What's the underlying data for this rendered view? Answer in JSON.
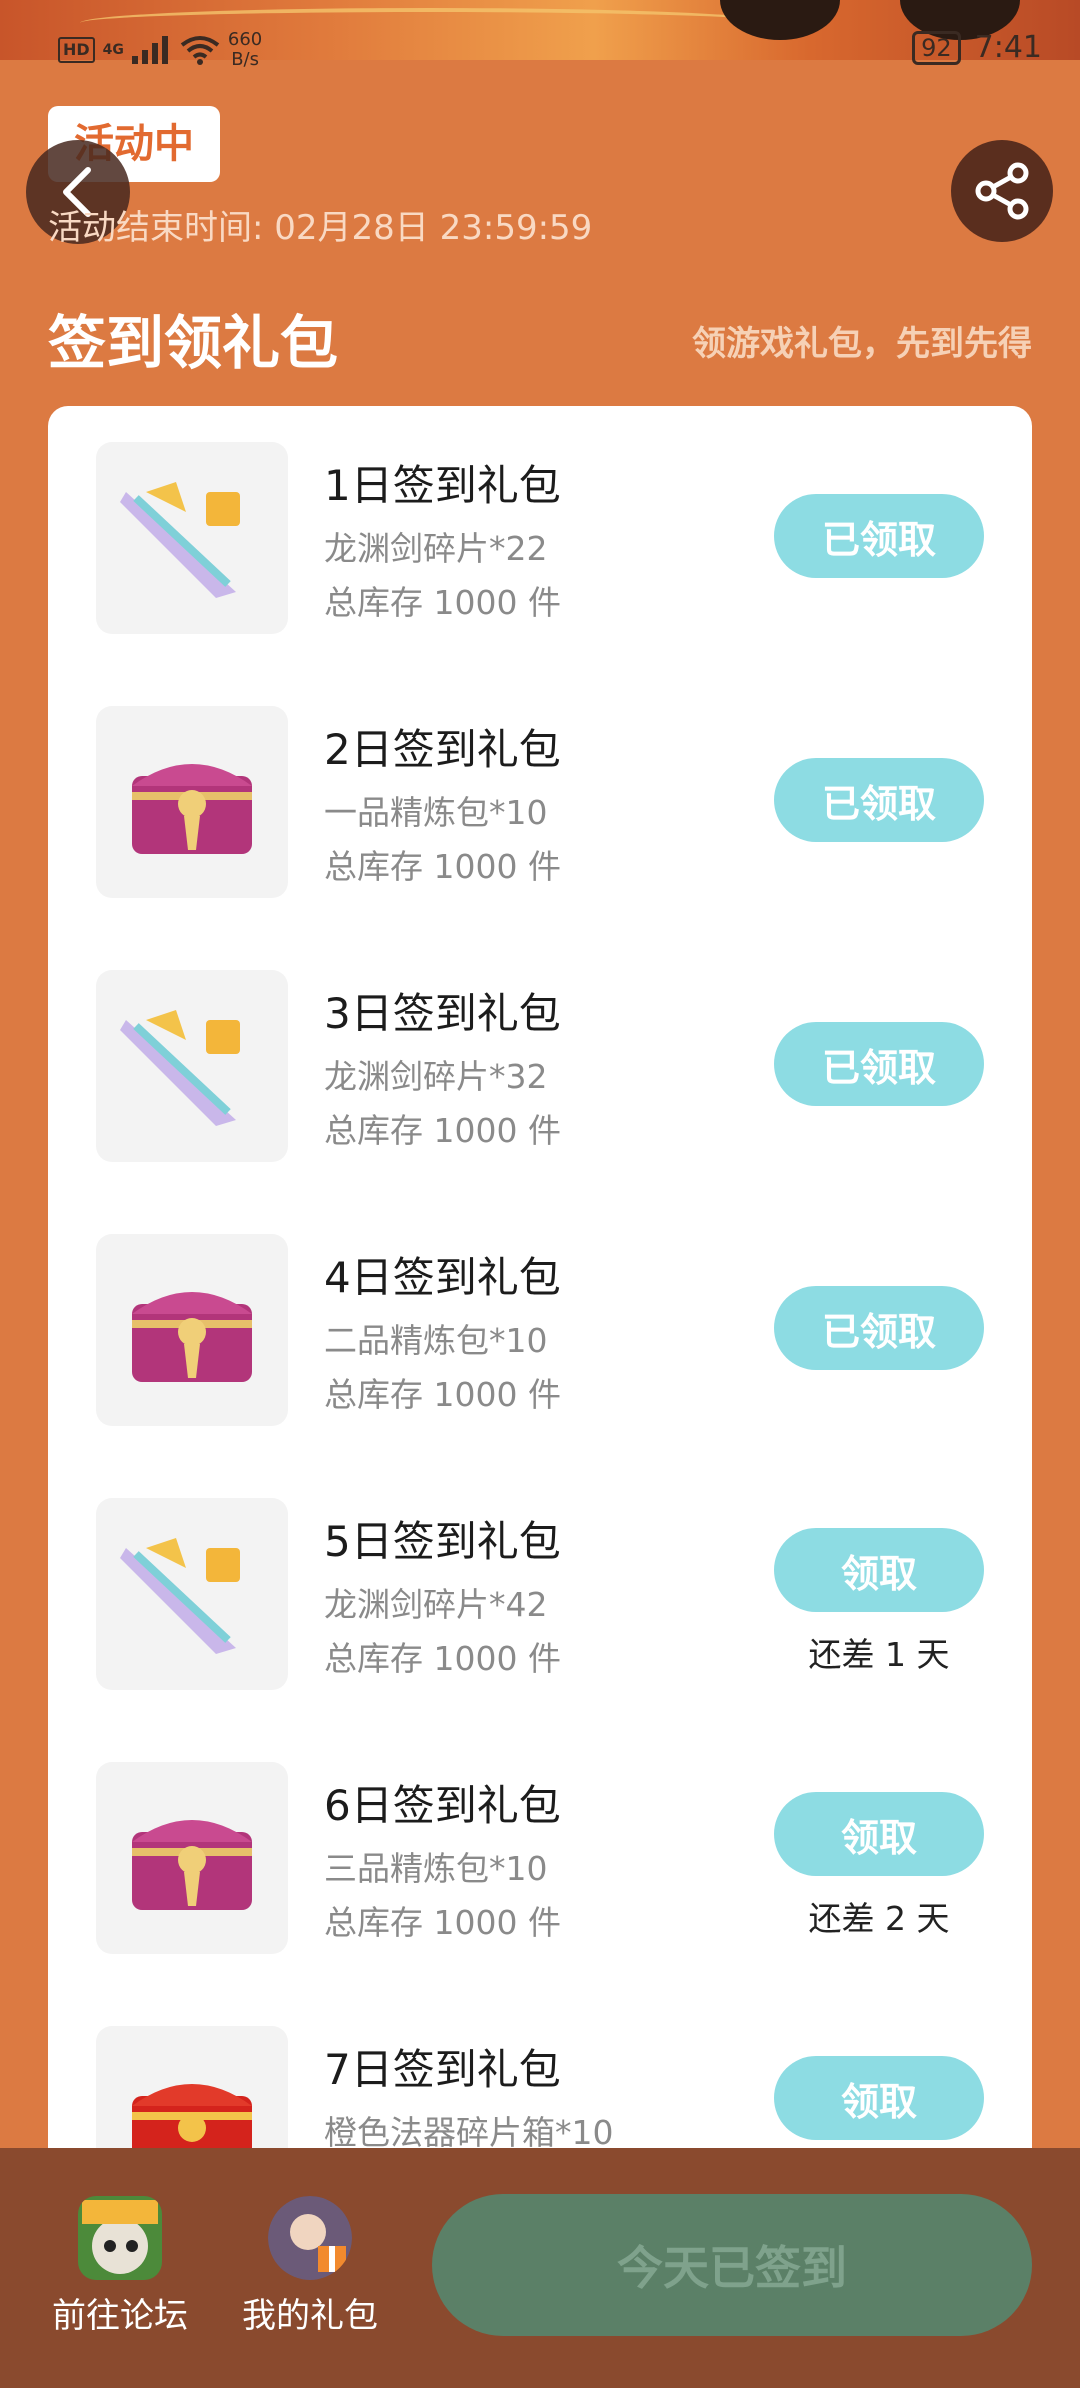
{
  "status_bar": {
    "hd": "HD",
    "network": "4G",
    "speed_value": "660",
    "speed_unit": "B/s",
    "battery": "92",
    "time": "7:41"
  },
  "header": {
    "status_tag": "活动中",
    "end_time": "活动结束时间: 02月28日 23:59:59",
    "section_title": "签到领礼包",
    "section_subtitle": "领游戏礼包，先到先得"
  },
  "gifts": [
    {
      "title": "1日签到礼包",
      "desc": "龙渊剑碎片*22",
      "stock": "总库存 1000 件",
      "button": "已领取",
      "remain": "",
      "icon": "sword-fragment-icon"
    },
    {
      "title": "2日签到礼包",
      "desc": "一品精炼包*10",
      "stock": "总库存 1000 件",
      "button": "已领取",
      "remain": "",
      "icon": "treasure-chest-icon"
    },
    {
      "title": "3日签到礼包",
      "desc": "龙渊剑碎片*32",
      "stock": "总库存 1000 件",
      "button": "已领取",
      "remain": "",
      "icon": "sword-fragment-icon"
    },
    {
      "title": "4日签到礼包",
      "desc": "二品精炼包*10",
      "stock": "总库存 1000 件",
      "button": "已领取",
      "remain": "",
      "icon": "treasure-chest-icon"
    },
    {
      "title": "5日签到礼包",
      "desc": "龙渊剑碎片*42",
      "stock": "总库存 1000 件",
      "button": "领取",
      "remain": "还差 1 天",
      "icon": "sword-fragment-icon"
    },
    {
      "title": "6日签到礼包",
      "desc": "三品精炼包*10",
      "stock": "总库存 1000 件",
      "button": "领取",
      "remain": "还差 2 天",
      "icon": "treasure-chest-icon"
    },
    {
      "title": "7日签到礼包",
      "desc": "橙色法器碎片箱*10",
      "stock": "",
      "button": "领取",
      "remain": "",
      "icon": "red-chest-icon"
    }
  ],
  "bottom_bar": {
    "forum_label": "前往论坛",
    "gifts_label": "我的礼包",
    "signed_label": "今天已签到"
  },
  "colors": {
    "background": "#DC7A42",
    "button": "#8DDCE3",
    "bottom_bar": "#8A4A2E",
    "signed_button": "#5B8067"
  }
}
